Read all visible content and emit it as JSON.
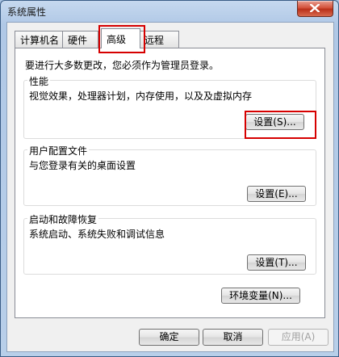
{
  "window": {
    "title": "系统属性"
  },
  "tabs": [
    {
      "label": "计算机名"
    },
    {
      "label": "硬件"
    },
    {
      "label": "高级"
    },
    {
      "label": "远程"
    }
  ],
  "main": {
    "note": "要进行大多数更改，您必须作为管理员登录。",
    "groups": [
      {
        "title": "性能",
        "desc": "视觉效果，处理器计划，内存使用，以及及虚拟内存",
        "button": "设置(S)..."
      },
      {
        "title": "用户配置文件",
        "desc": "与您登录有关的桌面设置",
        "button": "设置(E)..."
      },
      {
        "title": "启动和故障恢复",
        "desc": "系统启动、系统失败和调试信息",
        "button": "设置(T)..."
      }
    ],
    "env_button": "环境变量(N)..."
  },
  "footer": {
    "ok": "确定",
    "cancel": "取消",
    "apply": "应用(A)"
  },
  "colors": {
    "highlight": "#d60000",
    "close": "#c7452c"
  },
  "icons": {
    "close": "close-icon"
  }
}
